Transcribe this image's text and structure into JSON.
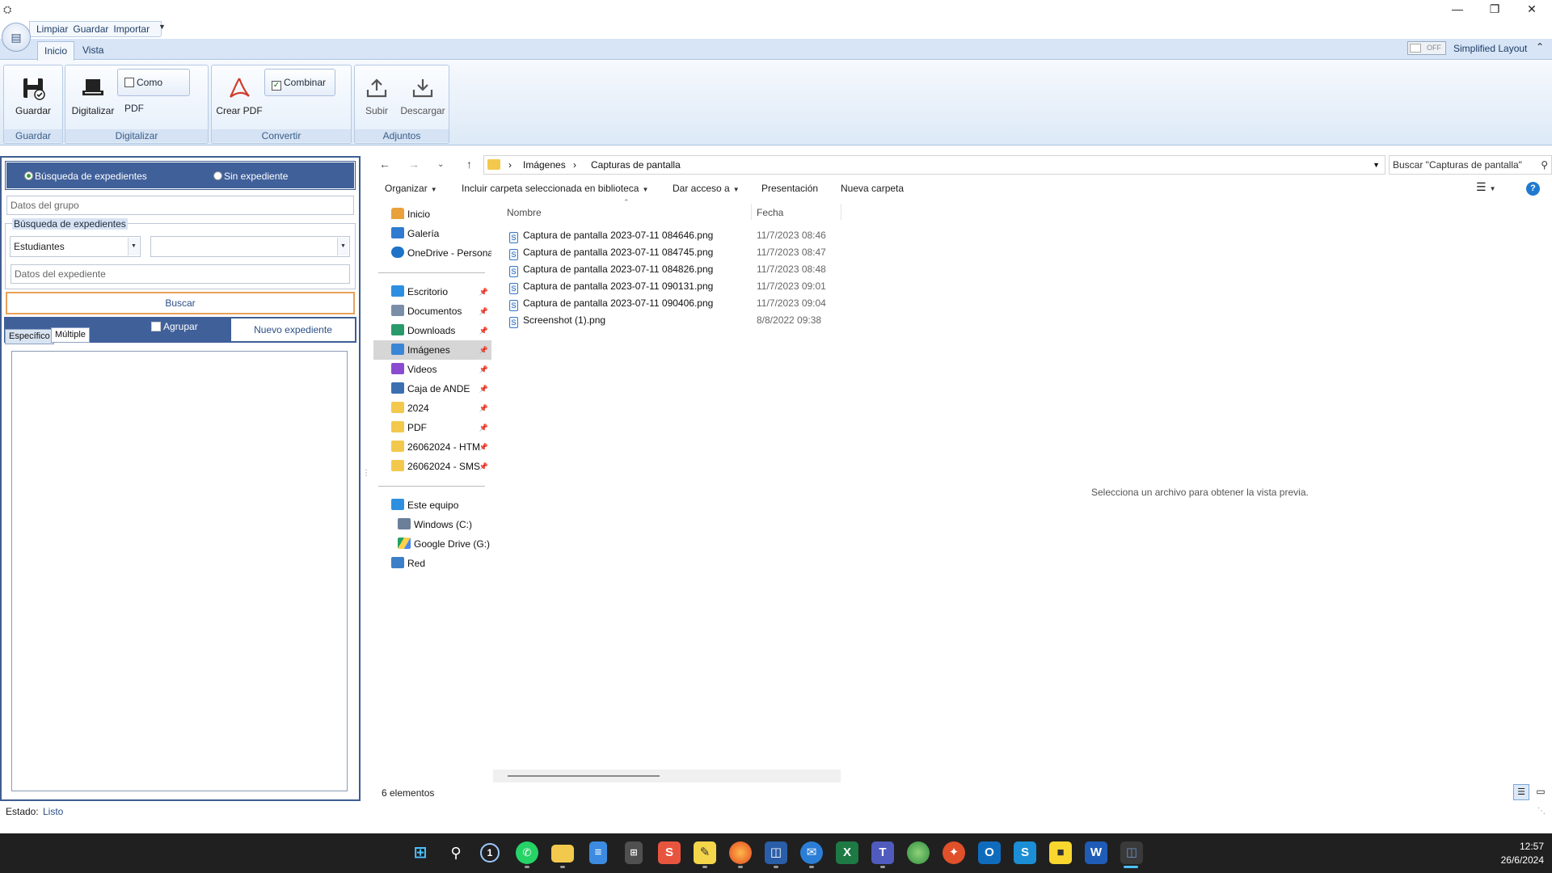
{
  "window": {
    "minimize_glyph": "—",
    "restore_glyph": "❐",
    "close_glyph": "✕"
  },
  "quick_access": {
    "items": [
      "Limpiar",
      "Guardar",
      "Importar"
    ]
  },
  "tabs": [
    "Inicio",
    "Vista"
  ],
  "layout_toggle": {
    "state": "OFF",
    "label": "Simplified Layout"
  },
  "ribbon": {
    "groups": [
      "Guardar",
      "Digitalizar",
      "Convertir",
      "Adjuntos"
    ],
    "buttons": {
      "guardar": "Guardar",
      "digitalizar": "Digitalizar",
      "como_pdf": "Como PDF",
      "crear_pdf": "Crear PDF",
      "combinar": "Combinar",
      "subir": "Subir",
      "descargar": "Descargar"
    },
    "como_pdf_checked": false,
    "combinar_checked": true
  },
  "search_panel": {
    "radio_busqueda": "Búsqueda de expedientes",
    "radio_sin": "Sin expediente",
    "selected_radio": "Búsqueda de expedientes",
    "grupo_placeholder": "Datos del grupo",
    "legend": "Búsqueda de expedientes",
    "combo_tipo": "Estudiantes",
    "combo_valor": "",
    "expediente_placeholder": "Datos del expediente",
    "buscar": "Buscar",
    "subtab_especifico": "Específico",
    "subtab_multiple": "Múltiple",
    "agrupar": "Agrupar",
    "nuevo_expediente": "Nuevo expediente"
  },
  "explorer": {
    "breadcrumb": [
      "Imágenes",
      "Capturas de pantalla"
    ],
    "search_placeholder": "Buscar  \"Capturas de pantalla\"",
    "commands": {
      "organizar": "Organizar",
      "incluir": "Incluir carpeta seleccionada en biblioteca",
      "dar_acceso": "Dar acceso a",
      "presentacion": "Presentación",
      "nueva_carpeta": "Nueva carpeta"
    },
    "nav_top": [
      "Inicio",
      "Galería",
      "OneDrive - Persona"
    ],
    "nav_pinned": [
      "Escritorio",
      "Documentos",
      "Downloads",
      "Imágenes",
      "Videos",
      "Caja de ANDE",
      "2024",
      "PDF",
      "26062024 - HTM",
      "26062024 - SMS"
    ],
    "nav_selected": "Imágenes",
    "nav_bottom": [
      "Este equipo",
      "Windows (C:)",
      "Google Drive (G:)",
      "Red"
    ],
    "columns": {
      "name": "Nombre",
      "date": "Fecha"
    },
    "files": [
      {
        "name": "Captura de pantalla 2023-07-11 084646.png",
        "date": "11/7/2023 08:46"
      },
      {
        "name": "Captura de pantalla 2023-07-11 084745.png",
        "date": "11/7/2023 08:47"
      },
      {
        "name": "Captura de pantalla 2023-07-11 084826.png",
        "date": "11/7/2023 08:48"
      },
      {
        "name": "Captura de pantalla 2023-07-11 090131.png",
        "date": "11/7/2023 09:01"
      },
      {
        "name": "Captura de pantalla 2023-07-11 090406.png",
        "date": "11/7/2023 09:04"
      },
      {
        "name": "Screenshot (1).png",
        "date": "8/8/2022 09:38"
      }
    ],
    "preview_text": "Selecciona un archivo para obtener la vista previa.",
    "item_count": "6 elementos"
  },
  "status": {
    "label": "Estado:",
    "value": "Listo"
  },
  "taskbar": {
    "time": "12:57",
    "date": "26/6/2024",
    "apps": [
      "windows-start",
      "search",
      "1password",
      "whatsapp",
      "file-explorer",
      "notepad",
      "calculator",
      "snagit",
      "sticky-app",
      "firefox",
      "remote-desktop",
      "thunderbird",
      "excel",
      "teams",
      "maps",
      "app-red",
      "outlook",
      "snagit-editor",
      "sticky-notes",
      "word",
      "scanner-app"
    ]
  }
}
